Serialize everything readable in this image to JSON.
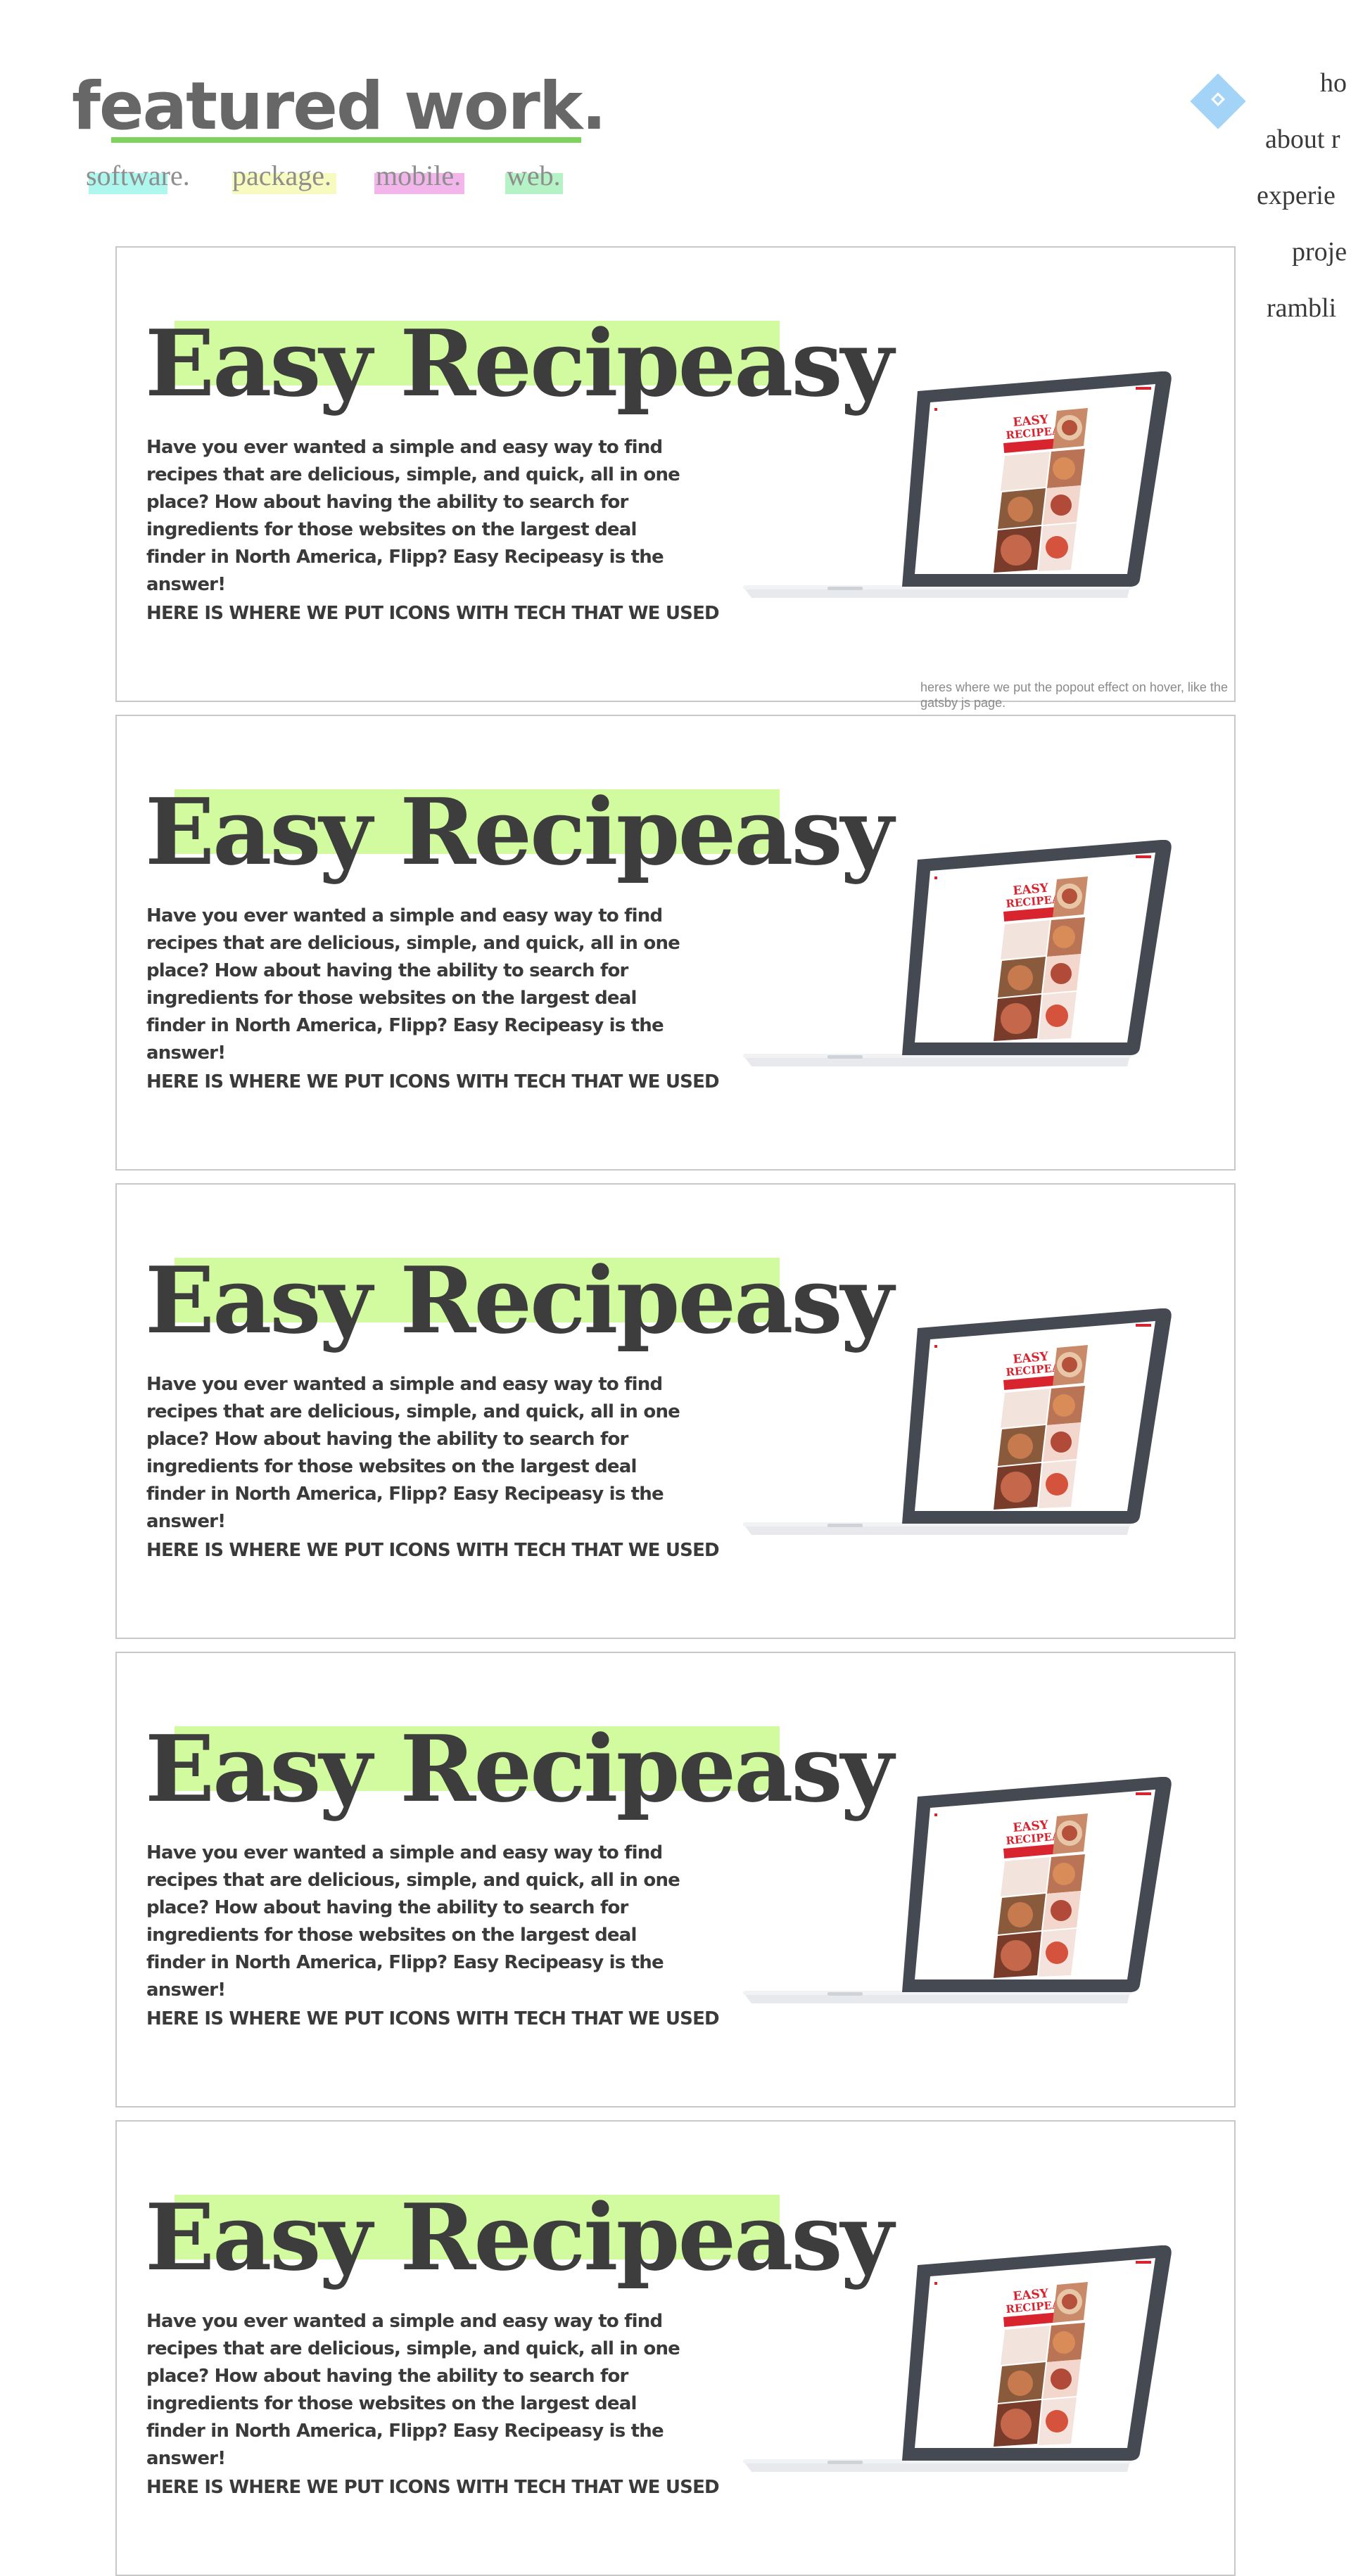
{
  "header": {
    "title": "featured work.",
    "categories": [
      {
        "label": "software",
        "dot": ".",
        "highlight": "#aef7ee"
      },
      {
        "label": "package",
        "dot": ".",
        "highlight": "#f8fbc0"
      },
      {
        "label": "mobile",
        "dot": ".",
        "highlight": "#f3b6ea"
      },
      {
        "label": "web",
        "dot": ".",
        "highlight": "#b5f2c5"
      }
    ],
    "underline_color": "#7ed35e"
  },
  "nav": {
    "logo_icon": "diamond-logo-icon",
    "logo_color": "#a3d3f7",
    "items": [
      {
        "label": "ho"
      },
      {
        "label": "about r"
      },
      {
        "label": "experie"
      },
      {
        "label": "proje"
      },
      {
        "label": "rambli"
      }
    ]
  },
  "projects": [
    {
      "title": "Easy Recipeasy",
      "description": "Have you ever wanted a simple and easy way to find recipes that are delicious, simple, and quick, all in one place? How about having the ability to search for ingredients for those websites on the largest deal finder in North America, Flipp? Easy Recipeasy is the answer!",
      "tech": "HERE IS WHERE WE PUT ICONS WITH TECH THAT WE USED",
      "highlight": "#d1fb9e"
    },
    {
      "title": "Easy Recipeasy",
      "description": "Have you ever wanted a simple and easy way to find recipes that are delicious, simple, and quick, all in one place? How about having the ability to search for ingredients for those websites on the largest deal finder in North America, Flipp? Easy Recipeasy is the answer!",
      "tech": "HERE IS WHERE WE PUT ICONS WITH TECH THAT WE USED",
      "highlight": "#d1fb9e"
    },
    {
      "title": "Easy Recipeasy",
      "description": "Have you ever wanted a simple and easy way to find recipes that are delicious, simple, and quick, all in one place? How about having the ability to search for ingredients for those websites on the largest deal finder in North America, Flipp? Easy Recipeasy is the answer!",
      "tech": "HERE IS WHERE WE PUT ICONS WITH TECH THAT WE USED",
      "highlight": "#d1fb9e"
    },
    {
      "title": "Easy Recipeasy",
      "description": "Have you ever wanted a simple and easy way to find recipes that are delicious, simple, and quick, all in one place? How about having the ability to search for ingredients for those websites on the largest deal finder in North America, Flipp? Easy Recipeasy is the answer!",
      "tech": "HERE IS WHERE WE PUT ICONS WITH TECH THAT WE USED",
      "highlight": "#d1fb9e"
    },
    {
      "title": "Easy Recipeasy",
      "description": "Have you ever wanted a simple and easy way to find recipes that are delicious, simple, and quick, all in one place? How about having the ability to search for ingredients for those websites on the largest deal finder in North America, Flipp? Easy Recipeasy is the answer!",
      "tech": "HERE IS WHERE WE PUT ICONS WITH TECH THAT WE USED",
      "highlight": "#d1fb9e"
    }
  ],
  "hover_note": "heres where we put the popout effect on hover, like the gatsby js page.",
  "mockup": {
    "screen_title_line1": "EASY",
    "screen_title_line2": "RECIPEASY",
    "brand_color": "#d8242f",
    "icon": "laptop-mockup-icon"
  }
}
